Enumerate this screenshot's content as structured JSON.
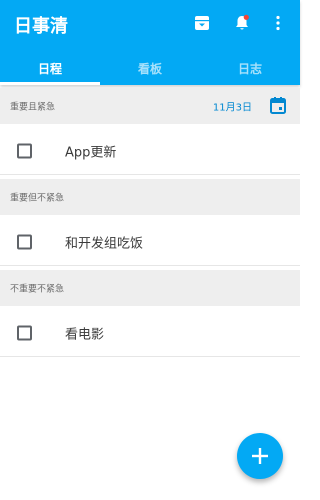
{
  "app": {
    "title": "日事清"
  },
  "toolbar": {
    "archive_icon": "archive-icon",
    "notification_icon": "bell-icon",
    "more_icon": "more-vertical-icon"
  },
  "tabs": [
    {
      "label": "日程",
      "active": true
    },
    {
      "label": "看板",
      "active": false
    },
    {
      "label": "日志",
      "active": false
    }
  ],
  "sections": [
    {
      "label": "重要且紧急",
      "date": "11月3日",
      "tasks": [
        "App更新"
      ]
    },
    {
      "label": "重要但不紧急",
      "tasks": [
        "和开发组吃饭"
      ]
    },
    {
      "label": "不重要不紧急",
      "tasks": [
        "看电影"
      ]
    }
  ],
  "fab": {
    "icon": "plus-icon"
  },
  "colors": {
    "primary": "#03a9f4",
    "date_text": "#0288d1"
  }
}
